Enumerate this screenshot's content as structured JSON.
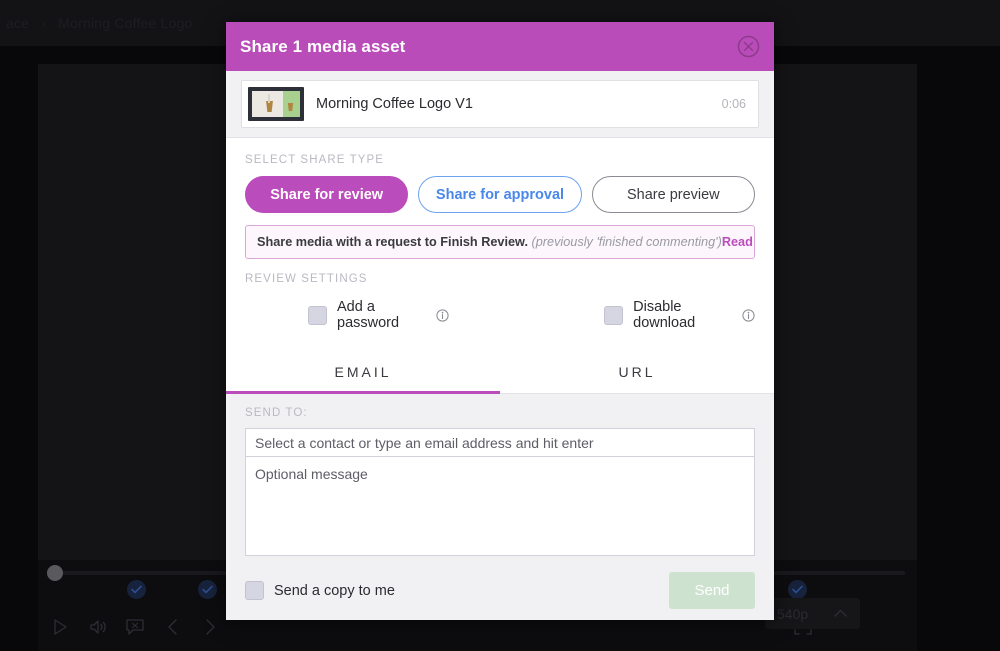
{
  "background": {
    "breadcrumb_tail": "ace",
    "breadcrumb_sep": "›",
    "breadcrumb_current": "Morning Coffee Logo",
    "player": {
      "play_icon": "play-icon",
      "volume_icon": "volume-icon",
      "comment_icon": "comment-icon",
      "prev_icon": "chevron-left-icon",
      "next_icon": "chevron-right-icon",
      "fullscreen_icon": "fullscreen-icon",
      "resolution_label": "540p",
      "resolution_chevron_icon": "chevron-up-icon"
    }
  },
  "modal": {
    "title": "Share 1 media asset",
    "close_icon": "close-circle-icon",
    "header_color": "#b94cb9",
    "asset": {
      "name": "Morning Coffee Logo V1",
      "duration": "0:06",
      "thumbnail_icon": "video-thumbnail"
    },
    "share_type": {
      "label": "SELECT SHARE TYPE",
      "options": [
        {
          "label": "Share for review",
          "state": "selected"
        },
        {
          "label": "Share for approval",
          "state": "blue"
        },
        {
          "label": "Share preview",
          "state": "plain"
        }
      ]
    },
    "notice": {
      "bold_text": "Share media with a request to Finish Review.",
      "italic_text": "(previously 'finished commenting')",
      "link_text": "Read more",
      "accent_color": "#bb4cbb"
    },
    "review_settings": {
      "label": "REVIEW SETTINGS",
      "options": [
        {
          "label": "Add a password",
          "checked": false,
          "info_icon": "info-icon"
        },
        {
          "label": "Disable download",
          "checked": false,
          "info_icon": "info-icon"
        }
      ]
    },
    "tabs": [
      {
        "label": "EMAIL",
        "active": true
      },
      {
        "label": "URL",
        "active": false
      }
    ],
    "send_panel": {
      "send_to_label": "SEND TO:",
      "contact_placeholder": "Select a contact or type an email address and hit enter",
      "contact_value": "",
      "message_placeholder": "Optional message",
      "message_value": "",
      "copy_to_me_label": "Send a copy to me",
      "copy_to_me_checked": false,
      "send_button_label": "Send",
      "send_button_enabled": false
    }
  }
}
